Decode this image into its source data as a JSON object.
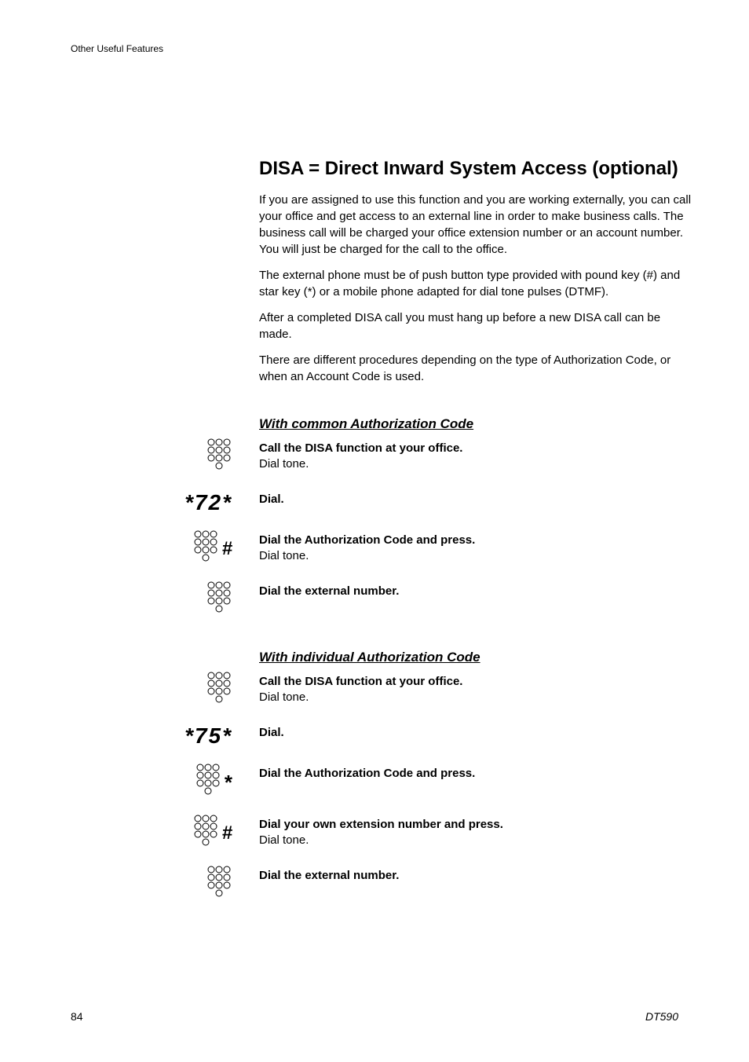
{
  "header": {
    "running": "Other Useful Features"
  },
  "title": "DISA = Direct Inward System Access (optional)",
  "paragraphs": {
    "p1": "If you are assigned to use this function and you are working externally, you can call your office and get access to an external line in order to make business calls. The business call will be charged your office extension number or an account number. You will just be charged for the call to the office.",
    "p2a": "The external phone must be of push button type provided with pound key (",
    "p2hash": "#",
    "p2b": ") and star key (",
    "p2star": "*",
    "p2c": ") or a mobile phone adapted for dial tone pulses (DTMF).",
    "p3": "After a completed DISA call you must hang up before a new DISA call can be made.",
    "p4": "There are different procedures depending on the type of Authorization Code, or when an Account Code is used."
  },
  "section1": {
    "heading": "With common Authorization Code",
    "steps": [
      {
        "icon": "keypad",
        "instr": "Call the DISA function at your office.",
        "sub": "Dial tone."
      },
      {
        "code": "*72*",
        "instr": "Dial."
      },
      {
        "icon": "keypad",
        "suffix": "#",
        "instr": "Dial the Authorization Code and press.",
        "sub": "Dial tone."
      },
      {
        "icon": "keypad",
        "instr": "Dial the external number."
      }
    ]
  },
  "section2": {
    "heading": "With individual Authorization Code",
    "steps": [
      {
        "icon": "keypad",
        "instr": "Call the DISA function at your office.",
        "sub": "Dial tone."
      },
      {
        "code": "*75*",
        "instr": "Dial."
      },
      {
        "icon": "keypad",
        "suffix": "*",
        "instr": "Dial the Authorization Code and press."
      },
      {
        "icon": "keypad",
        "suffix": "#",
        "instr": "Dial your own extension number and press.",
        "sub": "Dial tone."
      },
      {
        "icon": "keypad",
        "instr": "Dial the external number."
      }
    ]
  },
  "footer": {
    "page": "84",
    "model": "DT590"
  }
}
